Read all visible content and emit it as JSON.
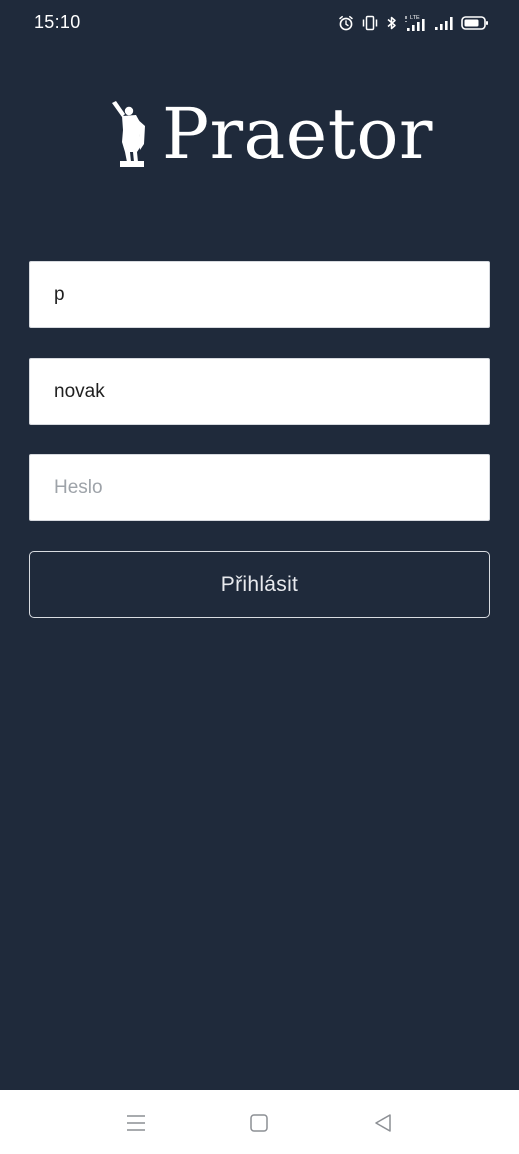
{
  "status_bar": {
    "time": "15:10",
    "icons": [
      "alarm-icon",
      "vibrate-icon",
      "bluetooth-icon",
      "lte-signal-icon",
      "signal-icon",
      "battery-icon"
    ],
    "lte_label": "LTE"
  },
  "app": {
    "logo_text": "Praetor",
    "logo_icon": "statue-icon"
  },
  "form": {
    "organization_value": "p",
    "username_value": "novak",
    "password_value": "",
    "password_placeholder": "Heslo",
    "login_label": "Přihlásit"
  },
  "nav_bar": {
    "icons": [
      "menu-icon",
      "home-icon",
      "back-icon"
    ]
  },
  "colors": {
    "background": "#1f2a3b",
    "field_background": "#ffffff",
    "button_border": "#d9dce1",
    "nav_background": "#ffffff"
  }
}
